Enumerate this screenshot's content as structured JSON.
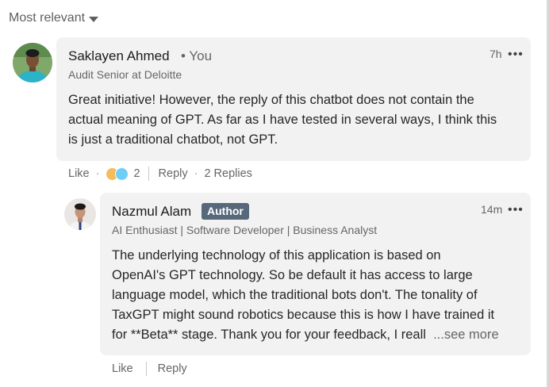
{
  "sort": {
    "label": "Most relevant"
  },
  "comment": {
    "author_name": "Saklayen Ahmed",
    "you_tag": "• You",
    "headline": "Audit Senior at Deloitte",
    "time": "7h",
    "more": "•••",
    "body_lines": [
      "Great initiative! However, the reply of this chatbot does not contain the",
      "actual meaning of GPT. As far as I have tested in several ways, I think this",
      "is just a traditional chatbot, not GPT."
    ],
    "actions": {
      "like": "Like",
      "dot1": "·",
      "reaction_count": "2",
      "reply": "Reply",
      "dot2": "·",
      "replies": "2 Replies"
    }
  },
  "reply": {
    "author_name": "Nazmul Alam",
    "badge": "Author",
    "headline": "AI Enthusiast | Software Developer | Business Analyst",
    "time": "14m",
    "more": "•••",
    "body_lines": [
      "The underlying technology of this application is based on",
      "OpenAI's GPT technology. So be default it has access to large",
      "language model, which the traditional bots don't. The tonality of",
      "TaxGPT might sound robotics because this is how I have trained it",
      "for **Beta** stage. Thank you for your feedback, I reall"
    ],
    "see_more": "...see more",
    "actions": {
      "like": "Like",
      "reply": "Reply"
    }
  },
  "colors": {
    "bubble_bg": "#f2f2f2",
    "badge_bg": "#56687a",
    "muted_text": "#666666"
  }
}
